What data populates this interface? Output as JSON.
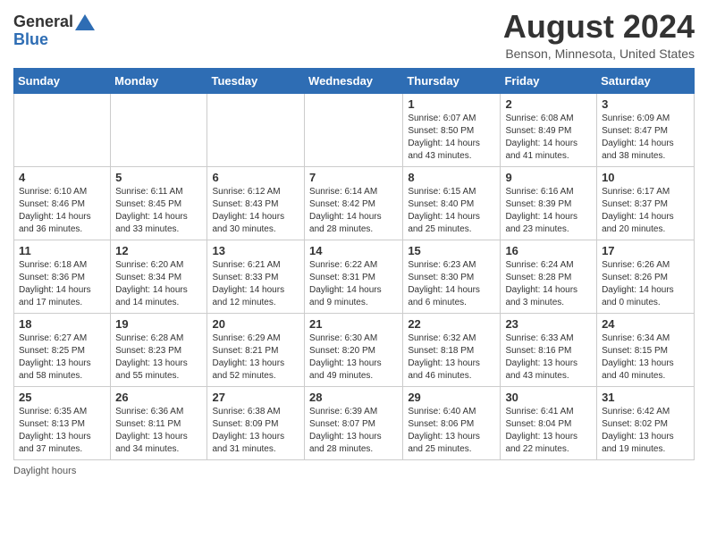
{
  "header": {
    "logo_general": "General",
    "logo_blue": "Blue",
    "main_title": "August 2024",
    "subtitle": "Benson, Minnesota, United States"
  },
  "calendar": {
    "days_of_week": [
      "Sunday",
      "Monday",
      "Tuesday",
      "Wednesday",
      "Thursday",
      "Friday",
      "Saturday"
    ],
    "weeks": [
      [
        {
          "day": "",
          "info": ""
        },
        {
          "day": "",
          "info": ""
        },
        {
          "day": "",
          "info": ""
        },
        {
          "day": "",
          "info": ""
        },
        {
          "day": "1",
          "info": "Sunrise: 6:07 AM\nSunset: 8:50 PM\nDaylight: 14 hours and 43 minutes."
        },
        {
          "day": "2",
          "info": "Sunrise: 6:08 AM\nSunset: 8:49 PM\nDaylight: 14 hours and 41 minutes."
        },
        {
          "day": "3",
          "info": "Sunrise: 6:09 AM\nSunset: 8:47 PM\nDaylight: 14 hours and 38 minutes."
        }
      ],
      [
        {
          "day": "4",
          "info": "Sunrise: 6:10 AM\nSunset: 8:46 PM\nDaylight: 14 hours and 36 minutes."
        },
        {
          "day": "5",
          "info": "Sunrise: 6:11 AM\nSunset: 8:45 PM\nDaylight: 14 hours and 33 minutes."
        },
        {
          "day": "6",
          "info": "Sunrise: 6:12 AM\nSunset: 8:43 PM\nDaylight: 14 hours and 30 minutes."
        },
        {
          "day": "7",
          "info": "Sunrise: 6:14 AM\nSunset: 8:42 PM\nDaylight: 14 hours and 28 minutes."
        },
        {
          "day": "8",
          "info": "Sunrise: 6:15 AM\nSunset: 8:40 PM\nDaylight: 14 hours and 25 minutes."
        },
        {
          "day": "9",
          "info": "Sunrise: 6:16 AM\nSunset: 8:39 PM\nDaylight: 14 hours and 23 minutes."
        },
        {
          "day": "10",
          "info": "Sunrise: 6:17 AM\nSunset: 8:37 PM\nDaylight: 14 hours and 20 minutes."
        }
      ],
      [
        {
          "day": "11",
          "info": "Sunrise: 6:18 AM\nSunset: 8:36 PM\nDaylight: 14 hours and 17 minutes."
        },
        {
          "day": "12",
          "info": "Sunrise: 6:20 AM\nSunset: 8:34 PM\nDaylight: 14 hours and 14 minutes."
        },
        {
          "day": "13",
          "info": "Sunrise: 6:21 AM\nSunset: 8:33 PM\nDaylight: 14 hours and 12 minutes."
        },
        {
          "day": "14",
          "info": "Sunrise: 6:22 AM\nSunset: 8:31 PM\nDaylight: 14 hours and 9 minutes."
        },
        {
          "day": "15",
          "info": "Sunrise: 6:23 AM\nSunset: 8:30 PM\nDaylight: 14 hours and 6 minutes."
        },
        {
          "day": "16",
          "info": "Sunrise: 6:24 AM\nSunset: 8:28 PM\nDaylight: 14 hours and 3 minutes."
        },
        {
          "day": "17",
          "info": "Sunrise: 6:26 AM\nSunset: 8:26 PM\nDaylight: 14 hours and 0 minutes."
        }
      ],
      [
        {
          "day": "18",
          "info": "Sunrise: 6:27 AM\nSunset: 8:25 PM\nDaylight: 13 hours and 58 minutes."
        },
        {
          "day": "19",
          "info": "Sunrise: 6:28 AM\nSunset: 8:23 PM\nDaylight: 13 hours and 55 minutes."
        },
        {
          "day": "20",
          "info": "Sunrise: 6:29 AM\nSunset: 8:21 PM\nDaylight: 13 hours and 52 minutes."
        },
        {
          "day": "21",
          "info": "Sunrise: 6:30 AM\nSunset: 8:20 PM\nDaylight: 13 hours and 49 minutes."
        },
        {
          "day": "22",
          "info": "Sunrise: 6:32 AM\nSunset: 8:18 PM\nDaylight: 13 hours and 46 minutes."
        },
        {
          "day": "23",
          "info": "Sunrise: 6:33 AM\nSunset: 8:16 PM\nDaylight: 13 hours and 43 minutes."
        },
        {
          "day": "24",
          "info": "Sunrise: 6:34 AM\nSunset: 8:15 PM\nDaylight: 13 hours and 40 minutes."
        }
      ],
      [
        {
          "day": "25",
          "info": "Sunrise: 6:35 AM\nSunset: 8:13 PM\nDaylight: 13 hours and 37 minutes."
        },
        {
          "day": "26",
          "info": "Sunrise: 6:36 AM\nSunset: 8:11 PM\nDaylight: 13 hours and 34 minutes."
        },
        {
          "day": "27",
          "info": "Sunrise: 6:38 AM\nSunset: 8:09 PM\nDaylight: 13 hours and 31 minutes."
        },
        {
          "day": "28",
          "info": "Sunrise: 6:39 AM\nSunset: 8:07 PM\nDaylight: 13 hours and 28 minutes."
        },
        {
          "day": "29",
          "info": "Sunrise: 6:40 AM\nSunset: 8:06 PM\nDaylight: 13 hours and 25 minutes."
        },
        {
          "day": "30",
          "info": "Sunrise: 6:41 AM\nSunset: 8:04 PM\nDaylight: 13 hours and 22 minutes."
        },
        {
          "day": "31",
          "info": "Sunrise: 6:42 AM\nSunset: 8:02 PM\nDaylight: 13 hours and 19 minutes."
        }
      ]
    ]
  },
  "footer": {
    "daylight_hours_label": "Daylight hours"
  }
}
